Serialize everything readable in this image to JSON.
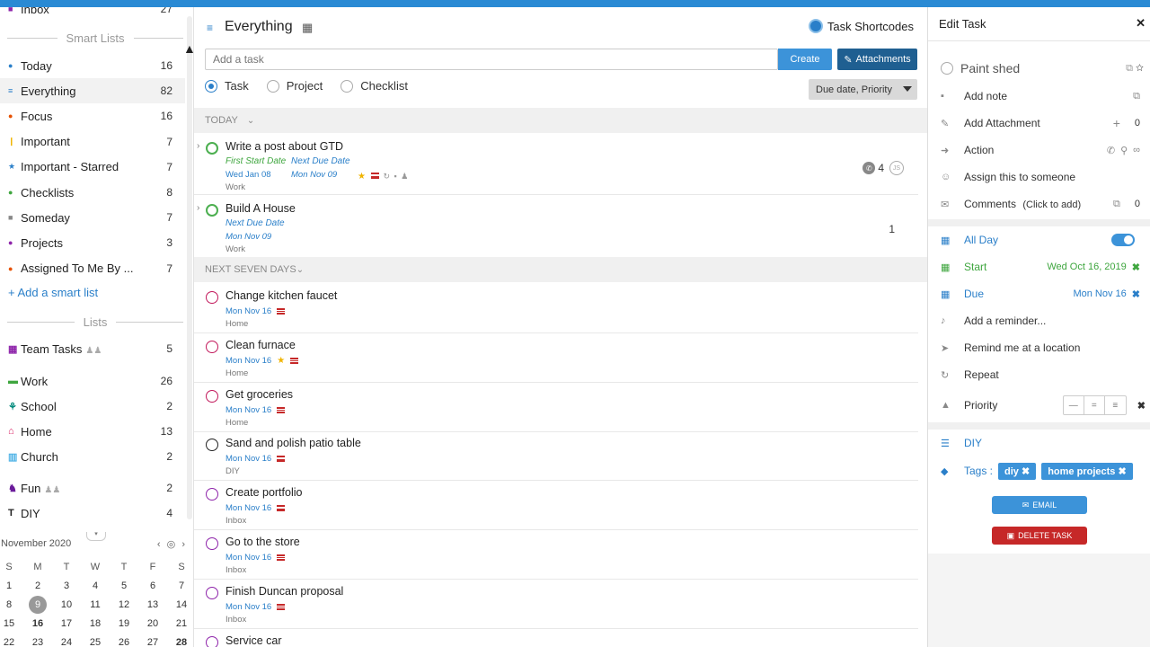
{
  "sidebar": {
    "top_item": {
      "label": "Inbox",
      "count": "27",
      "color": "#8e24aa"
    },
    "smart_lists_heading": "Smart Lists",
    "smart_items": [
      {
        "label": "Today",
        "count": "16",
        "icon": "today-icon",
        "color": "#2a7fc9"
      },
      {
        "label": "Everything",
        "count": "82",
        "icon": "everything-icon",
        "color": "#2a7fc9"
      },
      {
        "label": "Focus",
        "count": "16",
        "icon": "focus-icon",
        "color": "#e65100"
      },
      {
        "label": "Important",
        "count": "7",
        "icon": "important-icon",
        "color": "#f0b400"
      },
      {
        "label": "Important - Starred",
        "count": "7",
        "icon": "star-icon",
        "color": "#2a7fc9"
      },
      {
        "label": "Checklists",
        "count": "8",
        "icon": "checklist-icon",
        "color": "#3fa63f"
      },
      {
        "label": "Someday",
        "count": "7",
        "icon": "someday-icon",
        "color": "#888888"
      },
      {
        "label": "Projects",
        "count": "3",
        "icon": "project-icon",
        "color": "#8e24aa"
      },
      {
        "label": "Assigned To Me By ...",
        "count": "7",
        "icon": "assigned-icon",
        "color": "#e65100"
      }
    ],
    "add_smart_list": "Add a smart list",
    "lists_heading": "Lists",
    "lists": [
      {
        "label": "Team Tasks",
        "count": "5",
        "shared": true,
        "color": "#8e24aa"
      },
      {
        "label": "Work",
        "count": "26",
        "shared": false,
        "color": "#3fa63f"
      },
      {
        "label": "School",
        "count": "2",
        "shared": false,
        "color": "#00897b"
      },
      {
        "label": "Home",
        "count": "13",
        "shared": false,
        "color": "#d81b60"
      },
      {
        "label": "Church",
        "count": "2",
        "shared": false,
        "color": "#4fb3e6"
      },
      {
        "label": "Fun",
        "count": "2",
        "shared": true,
        "color": "#6a1b9a"
      },
      {
        "label": "DIY",
        "count": "4",
        "shared": false,
        "color": "#222222"
      }
    ]
  },
  "calendar": {
    "month": "November 2020",
    "days_of_week": [
      "S",
      "M",
      "T",
      "W",
      "T",
      "F",
      "S"
    ],
    "weeks": [
      [
        "1",
        "2",
        "3",
        "4",
        "5",
        "6",
        "7"
      ],
      [
        "8",
        "9",
        "10",
        "11",
        "12",
        "13",
        "14"
      ],
      [
        "15",
        "16",
        "17",
        "18",
        "19",
        "20",
        "21"
      ],
      [
        "22",
        "23",
        "24",
        "25",
        "26",
        "27",
        "28"
      ]
    ],
    "today": "9",
    "bold_days": [
      "16",
      "28"
    ]
  },
  "main": {
    "title": "Everything",
    "shortcodes_label": "Task Shortcodes",
    "add_task_placeholder": "Add a task",
    "create_label": "Create",
    "attachments_label": "Attachments",
    "radio_options": [
      "Task",
      "Project",
      "Checklist"
    ],
    "selected_radio": "Task",
    "sort_label": "Due date, Priority",
    "sections": [
      {
        "label": "TODAY"
      },
      {
        "label": "NEXT SEVEN DAYS"
      }
    ],
    "today_tasks": [
      {
        "name": "Write a post about GTD",
        "label1": "First Start Date",
        "label2": "Next Due Date",
        "date1": "Wed Jan 08",
        "date2": "Mon Nov 09",
        "list": "Work",
        "count": "4"
      },
      {
        "name": "Build A House",
        "label2": "Next Due Date",
        "date2": "Mon Nov 09",
        "list": "Work",
        "count": "1"
      }
    ],
    "week_tasks": [
      {
        "name": "Change kitchen faucet",
        "date": "Mon Nov 16",
        "list": "Home",
        "color": "#c2185b"
      },
      {
        "name": "Clean furnace",
        "date": "Mon Nov 16",
        "list": "Home",
        "color": "#c2185b",
        "star": true
      },
      {
        "name": "Get groceries",
        "date": "Mon Nov 16",
        "list": "Home",
        "color": "#c2185b"
      },
      {
        "name": "Sand and polish patio table",
        "date": "Mon Nov 16",
        "list": "DIY",
        "color": "#222222"
      },
      {
        "name": "Create portfolio",
        "date": "Mon Nov 16",
        "list": "Inbox",
        "color": "#8e24aa"
      },
      {
        "name": "Go to the store",
        "date": "Mon Nov 16",
        "list": "Inbox",
        "color": "#8e24aa"
      },
      {
        "name": "Finish Duncan proposal",
        "date": "Mon Nov 16",
        "list": "Inbox",
        "color": "#8e24aa"
      },
      {
        "name": "Service car",
        "date": "",
        "list": "",
        "color": "#8e24aa"
      }
    ]
  },
  "edit": {
    "heading": "Edit Task",
    "task_name": "Paint shed",
    "add_note": "Add note",
    "add_attachment": "Add Attachment",
    "attachment_count": "0",
    "action": "Action",
    "assign": "Assign this to someone",
    "comments": "Comments",
    "comments_hint": "(Click to add)",
    "comments_count": "0",
    "all_day": "All Day",
    "all_day_on": true,
    "start_label": "Start",
    "start_value": "Wed Oct 16, 2019",
    "due_label": "Due",
    "due_value": "Mon Nov 16",
    "reminder": "Add a reminder...",
    "location": "Remind me at a location",
    "repeat": "Repeat",
    "priority": "Priority",
    "list_name": "DIY",
    "tags_label": "Tags :",
    "tags": [
      "diy",
      "home projects"
    ],
    "email_label": "EMAIL",
    "delete_label": "DELETE TASK"
  }
}
